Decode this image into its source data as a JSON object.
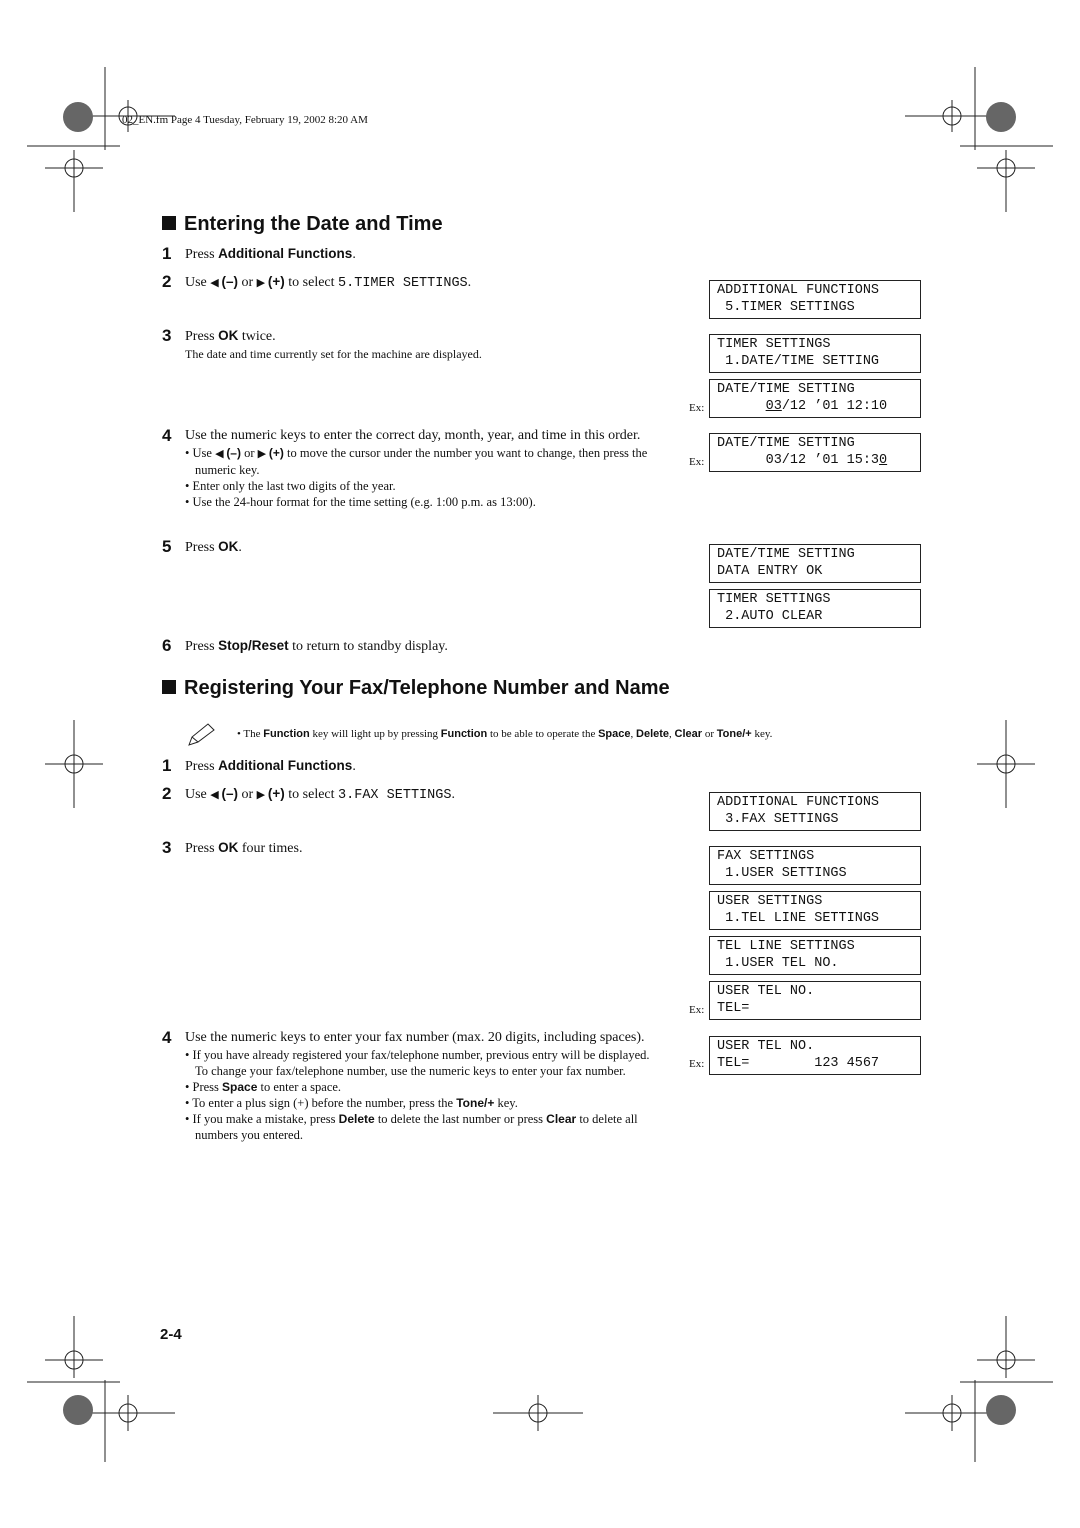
{
  "header": "02_EN.fm  Page 4  Tuesday, February 19, 2002  8:20 AM",
  "s1": {
    "title": "Entering the Date and Time",
    "st1": {
      "n": "1",
      "a": "Press ",
      "b": "Additional Functions",
      "c": "."
    },
    "st2": {
      "n": "2",
      "a": "Use ",
      "b1": "(–)",
      "or": " or ",
      "b2": "(+)",
      "c": " to select ",
      "m": "5.TIMER SETTINGS",
      "d": "."
    },
    "st3": {
      "n": "3",
      "a": "Press ",
      "b": "OK",
      "c": " twice.",
      "sub": "The date and time currently set for the machine are displayed."
    },
    "st4": {
      "n": "4",
      "a": "Use the numeric keys to enter the correct day, month, year, and time in this order.",
      "bul1a": "Use ",
      "bul1b1": "(–)",
      "bul1or": " or ",
      "bul1b2": "(+)",
      "bul1c": " to move the cursor under the number you want to change, then press the numeric key.",
      "bul2": "Enter only the last two digits of the year.",
      "bul3": "Use the 24-hour format for the time setting (e.g. 1:00 p.m. as 13:00)."
    },
    "st5": {
      "n": "5",
      "a": "Press ",
      "b": "OK",
      "c": "."
    },
    "st6": {
      "n": "6",
      "a": "Press ",
      "b": "Stop/Reset",
      "c": " to return to standby display."
    },
    "lcd": [
      {
        "l1": "ADDITIONAL FUNCTIONS",
        "l2": " 5.TIMER SETTINGS"
      },
      {
        "l1": "TIMER SETTINGS",
        "l2": " 1.DATE/TIME SETTING"
      },
      {
        "ex": "Ex:",
        "l1": "DATE/TIME SETTING",
        "l2a": "      ",
        "l2u": "03",
        "l2b": "/12 ’01 12:10"
      },
      {
        "ex": "Ex:",
        "l1": "DATE/TIME SETTING",
        "l2a": "      03/12 ’01 15:3",
        "l2u": "0",
        "l2b": ""
      },
      {
        "l1": "DATE/TIME SETTING",
        "l2": "DATA ENTRY OK"
      },
      {
        "l1": "TIMER SETTINGS",
        "l2": " 2.AUTO CLEAR"
      }
    ]
  },
  "s2": {
    "title": "Registering Your Fax/Telephone Number and Name",
    "note": {
      "a": "The ",
      "b1": "Function",
      "c": " key will light up by pressing ",
      "b2": "Function",
      "d": " to be able to operate the ",
      "b3": "Space",
      "e": ", ",
      "b4": "Delete",
      "f": ", ",
      "b5": "Clear",
      "g": " or ",
      "b6": "Tone/+",
      "h": " key."
    },
    "st1": {
      "n": "1",
      "a": "Press ",
      "b": "Additional Functions",
      "c": "."
    },
    "st2": {
      "n": "2",
      "a": "Use ",
      "b1": "(–)",
      "or": " or ",
      "b2": "(+)",
      "c": " to select ",
      "m": "3.FAX SETTINGS",
      "d": "."
    },
    "st3": {
      "n": "3",
      "a": "Press ",
      "b": "OK",
      "c": " four times."
    },
    "st4": {
      "n": "4",
      "a": "Use the numeric keys to enter your fax number (max. 20 digits, including spaces).",
      "bul1": "If you have already registered your fax/telephone number, previous entry will be displayed. To change your fax/telephone number, use the numeric keys to enter your fax number.",
      "bul2a": "Press ",
      "bul2b": "Space",
      "bul2c": " to enter a space.",
      "bul3a": "To enter a plus sign (+) before the number, press the ",
      "bul3b": "Tone/+",
      "bul3c": " key.",
      "bul4a": "If you make a mistake, press ",
      "bul4b": "Delete",
      "bul4c": " to delete the last number or press ",
      "bul4d": "Clear",
      "bul4e": " to delete all numbers you entered."
    },
    "lcd": [
      {
        "l1": "ADDITIONAL FUNCTIONS",
        "l2": " 3.FAX SETTINGS"
      },
      {
        "l1": "FAX SETTINGS",
        "l2": " 1.USER SETTINGS"
      },
      {
        "l1": "USER SETTINGS",
        "l2": " 1.TEL LINE SETTINGS"
      },
      {
        "l1": "TEL LINE SETTINGS",
        "l2": " 1.USER TEL NO."
      },
      {
        "ex": "Ex:",
        "l1": "USER TEL NO.",
        "l2": "TEL="
      },
      {
        "ex": "Ex:",
        "l1": "USER TEL NO.",
        "l2": "TEL=        123 4567"
      }
    ]
  },
  "page_number": "2-4"
}
